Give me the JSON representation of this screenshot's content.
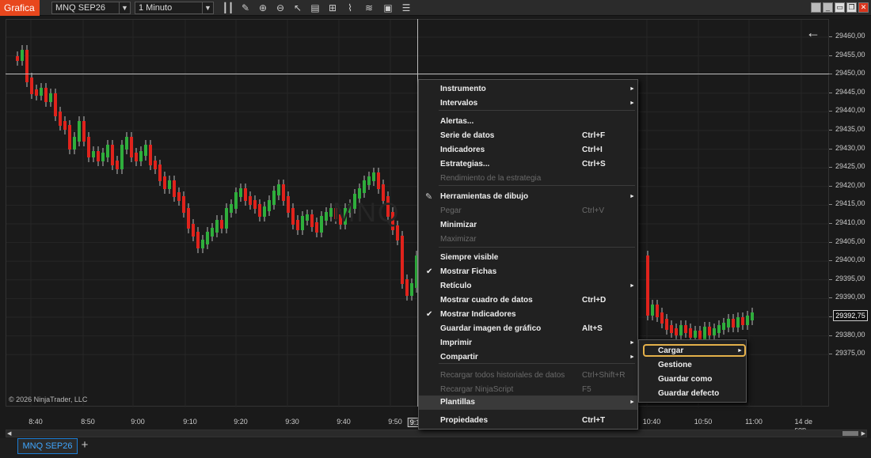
{
  "toolbar": {
    "app_label": "Grafica",
    "instrument": "MNQ SEP26",
    "interval": "1 Minuto",
    "icons": [
      "bars-icon",
      "pencil-icon",
      "zoom-in-icon",
      "zoom-out-icon",
      "pointer-icon",
      "data-box-icon",
      "strategy-icon",
      "indicators-icon",
      "properties-icon",
      "menu-list-icon"
    ]
  },
  "window_controls": [
    "restore-icon",
    "minimize-icon",
    "maximize-icon",
    "close-icon"
  ],
  "price_axis": {
    "labels": [
      "29460,00",
      "29455,00",
      "29450,00",
      "29445,00",
      "29440,00",
      "29435,00",
      "29430,00",
      "29425,00",
      "29420,00",
      "29415,00",
      "29410,00",
      "29405,00",
      "29400,00",
      "29395,00",
      "29390,00",
      "29385,00",
      "29380,00",
      "29375,00"
    ],
    "current_price": "29392,75"
  },
  "time_axis": {
    "labels": [
      "8:40",
      "8:50",
      "9:00",
      "9:10",
      "9:20",
      "9:30",
      "9:40",
      "9:50",
      "9:1",
      "10:40",
      "10:50",
      "11:00",
      "14 de sep."
    ]
  },
  "copyright": "© 2026 NinjaTrader, LLC",
  "watermark": "MNQ",
  "context_menu": {
    "items": [
      {
        "label": "Instrumento",
        "shortcut": "",
        "arrow": "►",
        "disabled": false
      },
      {
        "label": "Intervalos",
        "shortcut": "",
        "arrow": "►",
        "disabled": false
      },
      {
        "label": "Alertas...",
        "shortcut": "",
        "arrow": "",
        "disabled": false
      },
      {
        "label": "Serie de datos",
        "shortcut": "Ctrl+F",
        "arrow": "",
        "disabled": false
      },
      {
        "label": "Indicadores",
        "shortcut": "Ctrl+I",
        "arrow": "",
        "disabled": false
      },
      {
        "label": "Estrategias...",
        "shortcut": "Ctrl+S",
        "arrow": "",
        "disabled": false
      },
      {
        "label": "Rendimiento de la estrategia",
        "shortcut": "",
        "arrow": "",
        "disabled": true
      },
      {
        "label": "Herramientas de dibujo",
        "shortcut": "",
        "arrow": "►",
        "disabled": false
      },
      {
        "label": "Pegar",
        "shortcut": "Ctrl+V",
        "arrow": "",
        "disabled": true
      },
      {
        "label": "Minimizar",
        "shortcut": "",
        "arrow": "",
        "disabled": false
      },
      {
        "label": "Maximizar",
        "shortcut": "",
        "arrow": "",
        "disabled": true
      },
      {
        "label": "Siempre visible",
        "shortcut": "",
        "arrow": "",
        "disabled": false
      },
      {
        "label": "Mostrar Fichas",
        "shortcut": "",
        "arrow": "",
        "disabled": false
      },
      {
        "label": "Retículo",
        "shortcut": "",
        "arrow": "►",
        "disabled": false
      },
      {
        "label": "Mostrar cuadro de datos",
        "shortcut": "Ctrl+D",
        "arrow": "",
        "disabled": false
      },
      {
        "label": "Mostrar Indicadores",
        "shortcut": "",
        "arrow": "",
        "disabled": false
      },
      {
        "label": "Guardar imagen de gráfico",
        "shortcut": "Alt+S",
        "arrow": "",
        "disabled": false
      },
      {
        "label": "Imprimir",
        "shortcut": "",
        "arrow": "►",
        "disabled": false
      },
      {
        "label": "Compartir",
        "shortcut": "",
        "arrow": "►",
        "disabled": false
      },
      {
        "label": "Recargar todos historiales de datos",
        "shortcut": "Ctrl+Shift+R",
        "arrow": "",
        "disabled": true
      },
      {
        "label": "Recargar NinjaScript",
        "shortcut": "F5",
        "arrow": "",
        "disabled": true
      },
      {
        "label": "Plantillas",
        "shortcut": "",
        "arrow": "►",
        "disabled": false
      },
      {
        "label": "Propiedades",
        "shortcut": "Ctrl+T",
        "arrow": "",
        "disabled": false
      }
    ],
    "check_mark": "✔"
  },
  "submenu": {
    "items": [
      {
        "label": "Cargar",
        "arrow": "►"
      },
      {
        "label": "Gestione",
        "arrow": ""
      },
      {
        "label": "Guardar como",
        "arrow": ""
      },
      {
        "label": "Guardar defecto",
        "arrow": ""
      }
    ]
  },
  "tabs": {
    "active": "MNQ SEP26",
    "add": "+"
  },
  "colors": {
    "up": "#2fae3c",
    "down": "#e0231c",
    "accent": "#e8471d",
    "highlight": "#e4b04a",
    "tab": "#1d7ed4"
  }
}
